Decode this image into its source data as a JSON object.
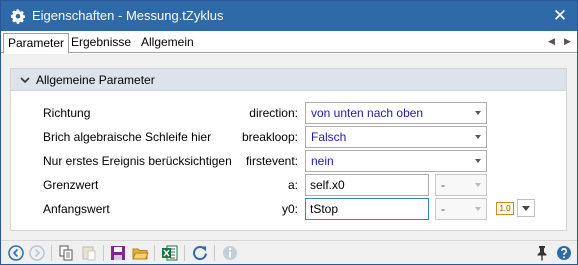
{
  "window": {
    "title": "Eigenschaften - Messung.tZyklus",
    "close_glyph": "✕"
  },
  "tabs": [
    {
      "label": "Parameter"
    },
    {
      "label": "Ergebnisse"
    },
    {
      "label": "Allgemein"
    }
  ],
  "group": {
    "title": "Allgemeine Parameter"
  },
  "params": [
    {
      "label": "Richtung",
      "key": "direction:",
      "value": "von unten nach oben"
    },
    {
      "label": "Brich algebraische Schleife hier",
      "key": "breakloop:",
      "value": "Falsch"
    },
    {
      "label": "Nur erstes Ereignis berücksichtigen",
      "key": "firstevent:",
      "value": "nein"
    },
    {
      "label": "Grenzwert",
      "key": "a:",
      "value": "self.x0",
      "unit": "-"
    },
    {
      "label": "Anfangswert",
      "key": "y0:",
      "value": "tStop",
      "unit": "-"
    }
  ],
  "value_badge": "1.0",
  "colors": {
    "title_bar": "#2f6aa8",
    "value_text": "#1c1cb0",
    "focus_border": "#3c7fd1"
  },
  "icons": {
    "title": "gear-icon",
    "statusbar": [
      "back-icon",
      "forward-icon",
      "copy-icon",
      "paste-icon",
      "save-icon",
      "open-folder-icon",
      "excel-icon",
      "refresh-icon",
      "info-icon",
      "pin-icon",
      "help-icon"
    ]
  }
}
